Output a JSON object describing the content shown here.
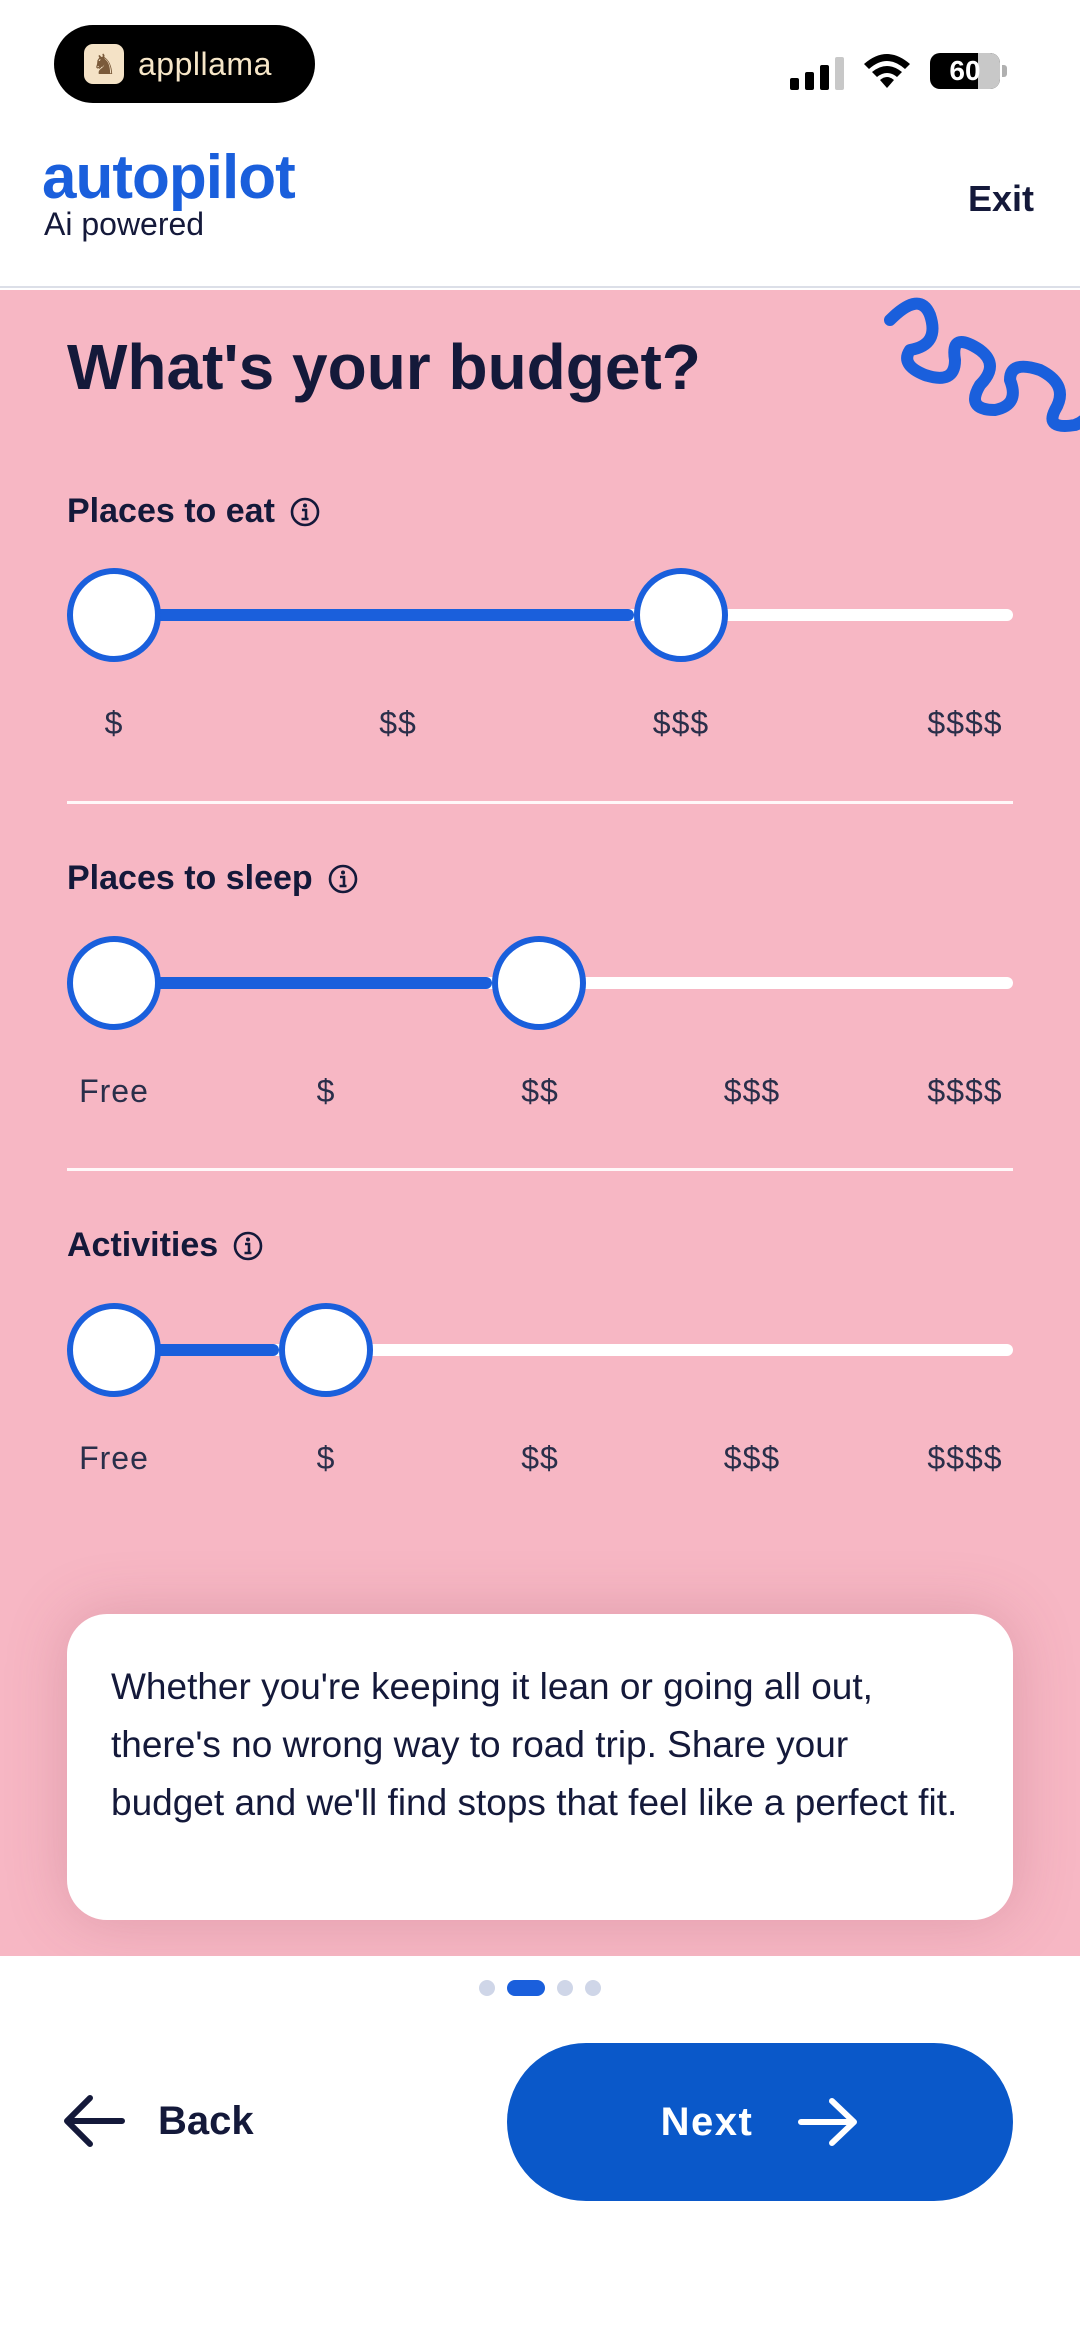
{
  "status_bar": {
    "app_pill_label": "appllama",
    "battery_level": "60"
  },
  "header": {
    "brand": "autopilot",
    "brand_subtitle": "Ai powered",
    "exit_label": "Exit"
  },
  "page": {
    "title": "What's your budget?"
  },
  "sliders": [
    {
      "label": "Places to eat",
      "ticks": [
        "$",
        "$$",
        "$$$",
        "$$$$"
      ],
      "range_min_index": 0,
      "range_max_index": 2
    },
    {
      "label": "Places to sleep",
      "ticks": [
        "Free",
        "$",
        "$$",
        "$$$",
        "$$$$"
      ],
      "range_min_index": 0,
      "range_max_index": 2
    },
    {
      "label": "Activities",
      "ticks": [
        "Free",
        "$",
        "$$",
        "$$$",
        "$$$$"
      ],
      "range_min_index": 0,
      "range_max_index": 1
    }
  ],
  "note": {
    "text": "Whether you're keeping it lean or going all out, there's no wrong way to road trip. Share your budget and we'll find stops that feel like a perfect fit."
  },
  "pagination": {
    "total": 4,
    "current": 2
  },
  "footer": {
    "back_label": "Back",
    "next_label": "Next"
  },
  "colors": {
    "accent": "#1a5fdc",
    "button": "#0a58c9",
    "background_pink": "#f7b7c4",
    "text_dark": "#14193a"
  }
}
